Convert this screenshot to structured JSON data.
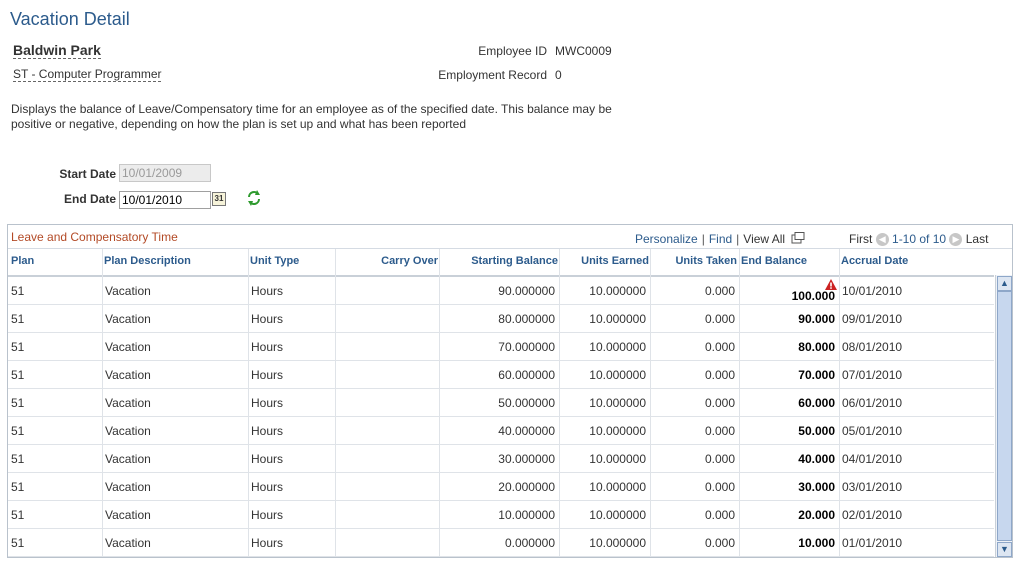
{
  "page": {
    "title": "Vacation Detail"
  },
  "employee": {
    "name": "Baldwin Park",
    "job": "ST - Computer Programmer",
    "id_label": "Employee ID",
    "id_value": "MWC0009",
    "record_label": "Employment Record",
    "record_value": "0"
  },
  "description": "Displays the balance of Leave/Compensatory time for an employee as of the specified date. This balance may be positive or negative, depending on how the plan is set up and what has been reported",
  "dates": {
    "start_label": "Start Date",
    "start_value": "10/01/2009",
    "end_label": "End Date",
    "end_value": "10/01/2010",
    "calendar_icon": "calendar-icon",
    "calendar_glyph": "31",
    "refresh_icon": "refresh-icon"
  },
  "grid": {
    "title": "Leave and Compensatory Time",
    "personalize": "Personalize",
    "find": "Find",
    "view_all": "View All",
    "first": "First",
    "range": "1-10 of 10",
    "last": "Last",
    "prev_glyph": "◀",
    "next_glyph": "▶",
    "up_glyph": "▲",
    "down_glyph": "▼",
    "columns": [
      "Plan",
      "Plan Description",
      "Unit Type",
      "Carry Over",
      "Starting Balance",
      "Units Earned",
      "Units Taken",
      "End Balance",
      "Accrual Date"
    ],
    "rows": [
      {
        "plan": "51",
        "desc": "Vacation",
        "unit": "Hours",
        "carry": "",
        "start": "90.000000",
        "earned": "10.000000",
        "taken": "0.000",
        "end": "100.000",
        "date": "10/01/2010",
        "warning": true
      },
      {
        "plan": "51",
        "desc": "Vacation",
        "unit": "Hours",
        "carry": "",
        "start": "80.000000",
        "earned": "10.000000",
        "taken": "0.000",
        "end": "90.000",
        "date": "09/01/2010"
      },
      {
        "plan": "51",
        "desc": "Vacation",
        "unit": "Hours",
        "carry": "",
        "start": "70.000000",
        "earned": "10.000000",
        "taken": "0.000",
        "end": "80.000",
        "date": "08/01/2010"
      },
      {
        "plan": "51",
        "desc": "Vacation",
        "unit": "Hours",
        "carry": "",
        "start": "60.000000",
        "earned": "10.000000",
        "taken": "0.000",
        "end": "70.000",
        "date": "07/01/2010"
      },
      {
        "plan": "51",
        "desc": "Vacation",
        "unit": "Hours",
        "carry": "",
        "start": "50.000000",
        "earned": "10.000000",
        "taken": "0.000",
        "end": "60.000",
        "date": "06/01/2010"
      },
      {
        "plan": "51",
        "desc": "Vacation",
        "unit": "Hours",
        "carry": "",
        "start": "40.000000",
        "earned": "10.000000",
        "taken": "0.000",
        "end": "50.000",
        "date": "05/01/2010"
      },
      {
        "plan": "51",
        "desc": "Vacation",
        "unit": "Hours",
        "carry": "",
        "start": "30.000000",
        "earned": "10.000000",
        "taken": "0.000",
        "end": "40.000",
        "date": "04/01/2010"
      },
      {
        "plan": "51",
        "desc": "Vacation",
        "unit": "Hours",
        "carry": "",
        "start": "20.000000",
        "earned": "10.000000",
        "taken": "0.000",
        "end": "30.000",
        "date": "03/01/2010"
      },
      {
        "plan": "51",
        "desc": "Vacation",
        "unit": "Hours",
        "carry": "",
        "start": "10.000000",
        "earned": "10.000000",
        "taken": "0.000",
        "end": "20.000",
        "date": "02/01/2010"
      },
      {
        "plan": "51",
        "desc": "Vacation",
        "unit": "Hours",
        "carry": "",
        "start": "0.000000",
        "earned": "10.000000",
        "taken": "0.000",
        "end": "10.000",
        "date": "01/01/2010"
      }
    ]
  },
  "colors": {
    "title_blue": "#2c5b8c",
    "grid_title": "#b34a26",
    "warning_red": "#cc2222"
  }
}
